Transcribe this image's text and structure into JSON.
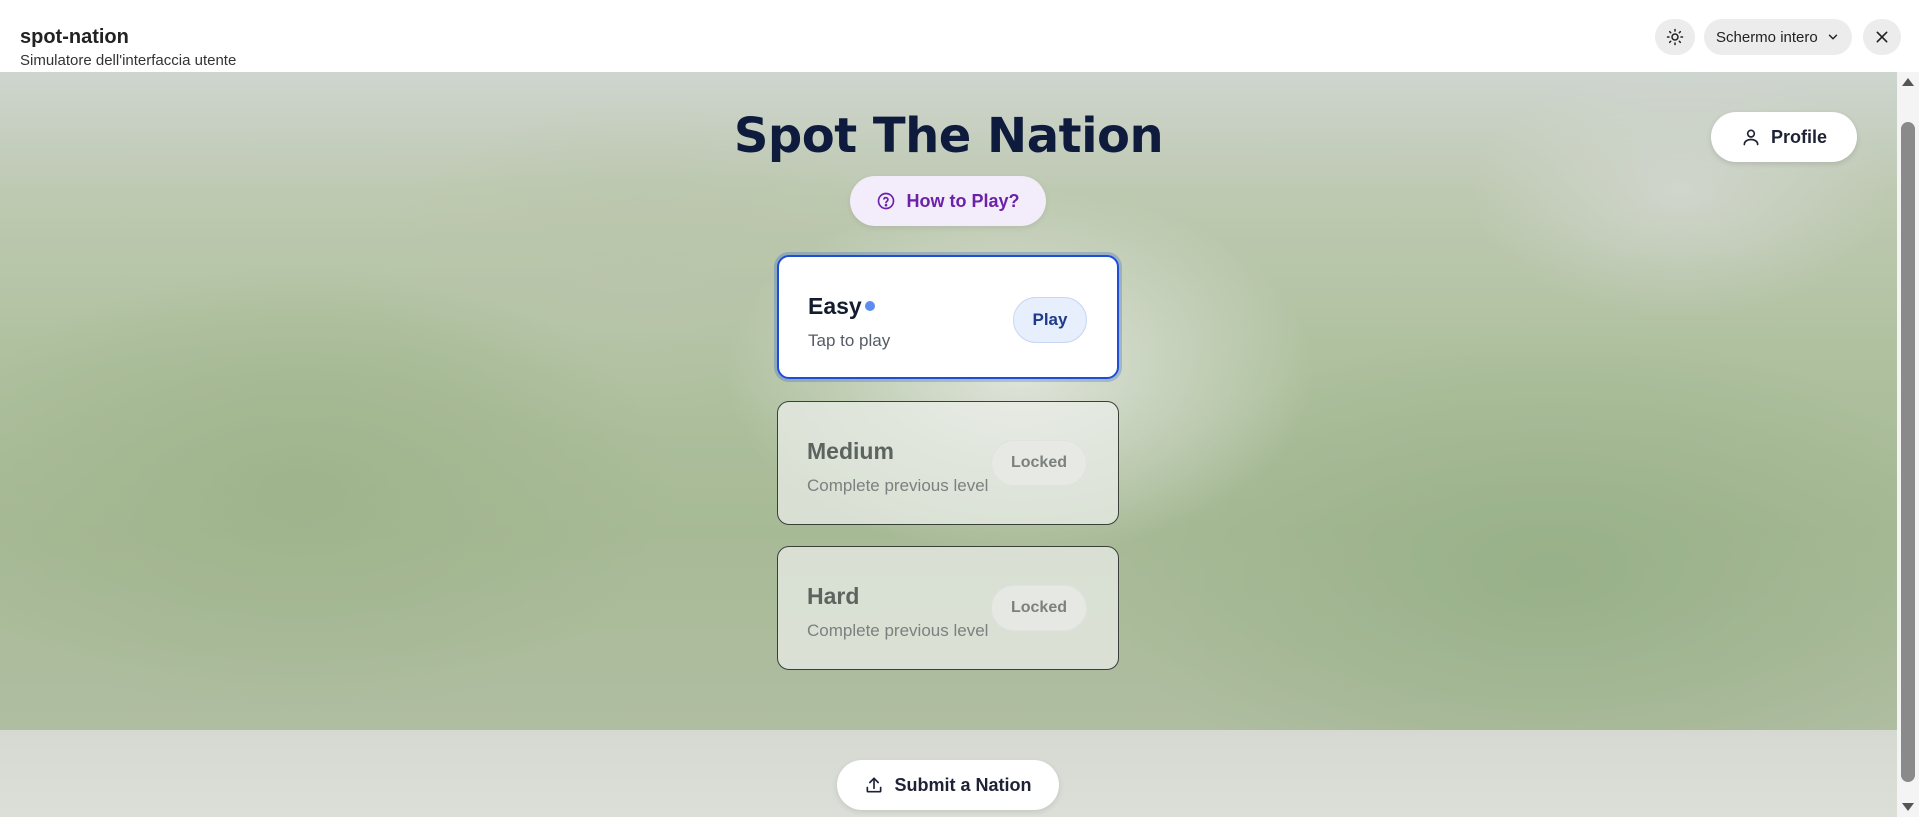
{
  "app": {
    "title": "spot-nation",
    "subtitle": "Simulatore dell'interfaccia utente",
    "fullscreen_label": "Schermo intero"
  },
  "game": {
    "title": "Spot The Nation",
    "how_to_play_label": "How to Play?",
    "profile_label": "Profile",
    "submit_label": "Submit a Nation"
  },
  "levels": [
    {
      "name": "Easy",
      "subtitle": "Tap to play",
      "action": "Play",
      "status": "unlocked"
    },
    {
      "name": "Medium",
      "subtitle": "Complete previous level",
      "action": "Locked",
      "status": "locked"
    },
    {
      "name": "Hard",
      "subtitle": "Complete previous level",
      "action": "Locked",
      "status": "locked"
    }
  ],
  "colors": {
    "title": "#0f1b3d",
    "accent_purple": "#6b21a8",
    "active_border": "#1d4ed8",
    "indicator_dot": "#5b8def"
  },
  "icons": {
    "theme": "sun-icon",
    "fullscreen_dropdown": "chevron-down-icon",
    "close": "close-icon",
    "how_to_play": "question-circle-icon",
    "profile": "user-icon",
    "submit": "upload-icon"
  }
}
